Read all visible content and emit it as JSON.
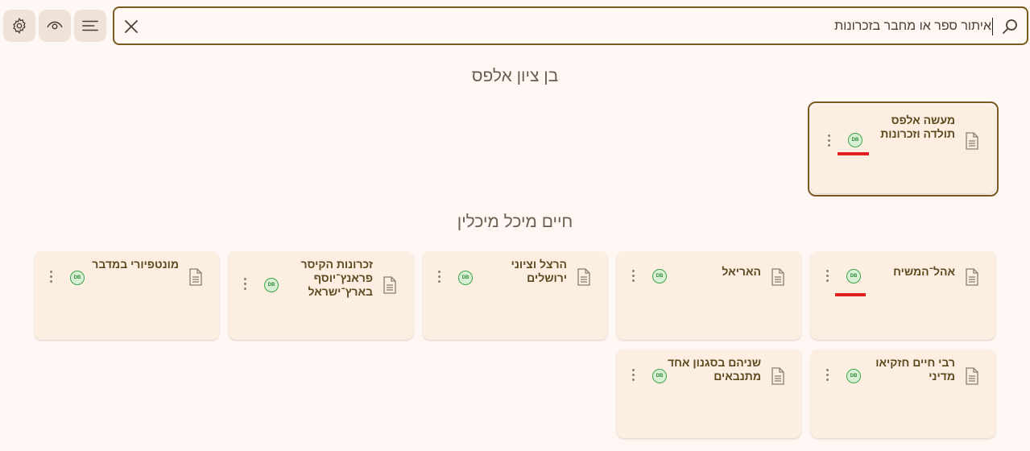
{
  "toolbar": {
    "settings_icon": "gear-icon",
    "visibility_icon": "eye-icon",
    "menu_icon": "menu-lines-icon"
  },
  "search": {
    "value": "איתור ספר או מחבר בזכרונות",
    "clear_icon": "close-icon",
    "search_icon": "search-icon"
  },
  "sections": [
    {
      "author": "בן ציון אלפס",
      "books": [
        {
          "title": "מעשה אלפס תולדה וזכרונות",
          "badge": "DB"
        }
      ]
    },
    {
      "author": "חיים מיכל מיכלין",
      "books": [
        {
          "title": "אהל־המשיח",
          "badge": "DB"
        },
        {
          "title": "האריאל",
          "badge": "DB"
        },
        {
          "title": "הרצל וציוני ירושלים",
          "badge": "DB"
        },
        {
          "title": "זכרונות הקיסר פראנץ־יוסף בארץ־ישראל",
          "badge": "DB"
        },
        {
          "title": "מונטפיורי במדבר",
          "badge": "DB"
        },
        {
          "title": "רבי חיים חזקיאו מדיני",
          "badge": "DB"
        },
        {
          "title": "שניהם בסגנון אחד מתנבאים",
          "badge": "DB"
        }
      ]
    }
  ]
}
